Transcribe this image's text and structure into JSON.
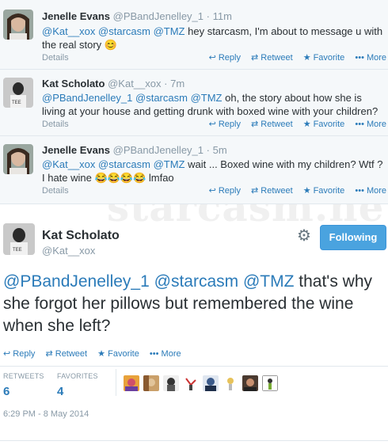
{
  "watermark": "starcasm.net",
  "tweets": [
    {
      "name": "Jenelle Evans",
      "handle": "@PBandJenelley_1",
      "time": "11m",
      "segments": [
        {
          "text": "@Kat__xox",
          "mention": true
        },
        {
          "text": " ",
          "mention": false
        },
        {
          "text": "@starcasm",
          "mention": true
        },
        {
          "text": " ",
          "mention": false
        },
        {
          "text": "@TMZ",
          "mention": true
        },
        {
          "text": " hey starcasm, I'm about to message u with the real story ",
          "mention": false
        },
        {
          "text": "😊",
          "mention": false
        }
      ],
      "details": "Details"
    },
    {
      "name": "Kat Scholato",
      "handle": "@Kat__xox",
      "time": "7m",
      "segments": [
        {
          "text": "@PBandJenelley_1",
          "mention": true
        },
        {
          "text": " ",
          "mention": false
        },
        {
          "text": "@starcasm",
          "mention": true
        },
        {
          "text": " ",
          "mention": false
        },
        {
          "text": "@TMZ",
          "mention": true
        },
        {
          "text": " oh, the story about how she is living at your house and getting drunk with boxed wine with your children?",
          "mention": false
        }
      ],
      "details": "Details"
    },
    {
      "name": "Jenelle Evans",
      "handle": "@PBandJenelley_1",
      "time": "5m",
      "segments": [
        {
          "text": "@Kat__xox",
          "mention": true
        },
        {
          "text": " ",
          "mention": false
        },
        {
          "text": "@starcasm",
          "mention": true
        },
        {
          "text": " ",
          "mention": false
        },
        {
          "text": "@TMZ",
          "mention": true
        },
        {
          "text": " wait ... Boxed wine with my children? Wtf ? I hate wine ",
          "mention": false
        },
        {
          "text": "😂😂😂😂",
          "mention": false
        },
        {
          "text": " lmfao",
          "mention": false
        }
      ],
      "details": "Details"
    }
  ],
  "actions": {
    "reply": "Reply",
    "retweet": "Retweet",
    "favorite": "Favorite",
    "more": "More"
  },
  "main": {
    "name": "Kat Scholato",
    "handle": "@Kat__xox",
    "follow_label": "Following",
    "mentions": [
      "@PBandJenelley_1",
      "@starcasm",
      "@TMZ"
    ],
    "text": "that's why she forgot her pillows but remembered the wine when she left?",
    "stats": {
      "retweets_label": "RETWEETS",
      "retweets": "6",
      "favorites_label": "FAVORITES",
      "favorites": "4"
    },
    "timestamp": "6:29 PM - 8 May 2014"
  },
  "colors": {
    "link": "#2b7bb9",
    "following_button": "#4aa3df",
    "tweet_bg": "#f5f8fa",
    "muted": "#8899a6"
  },
  "icons": [
    "reply-icon",
    "retweet-icon",
    "star-icon",
    "more-dots-icon",
    "gear-icon"
  ]
}
